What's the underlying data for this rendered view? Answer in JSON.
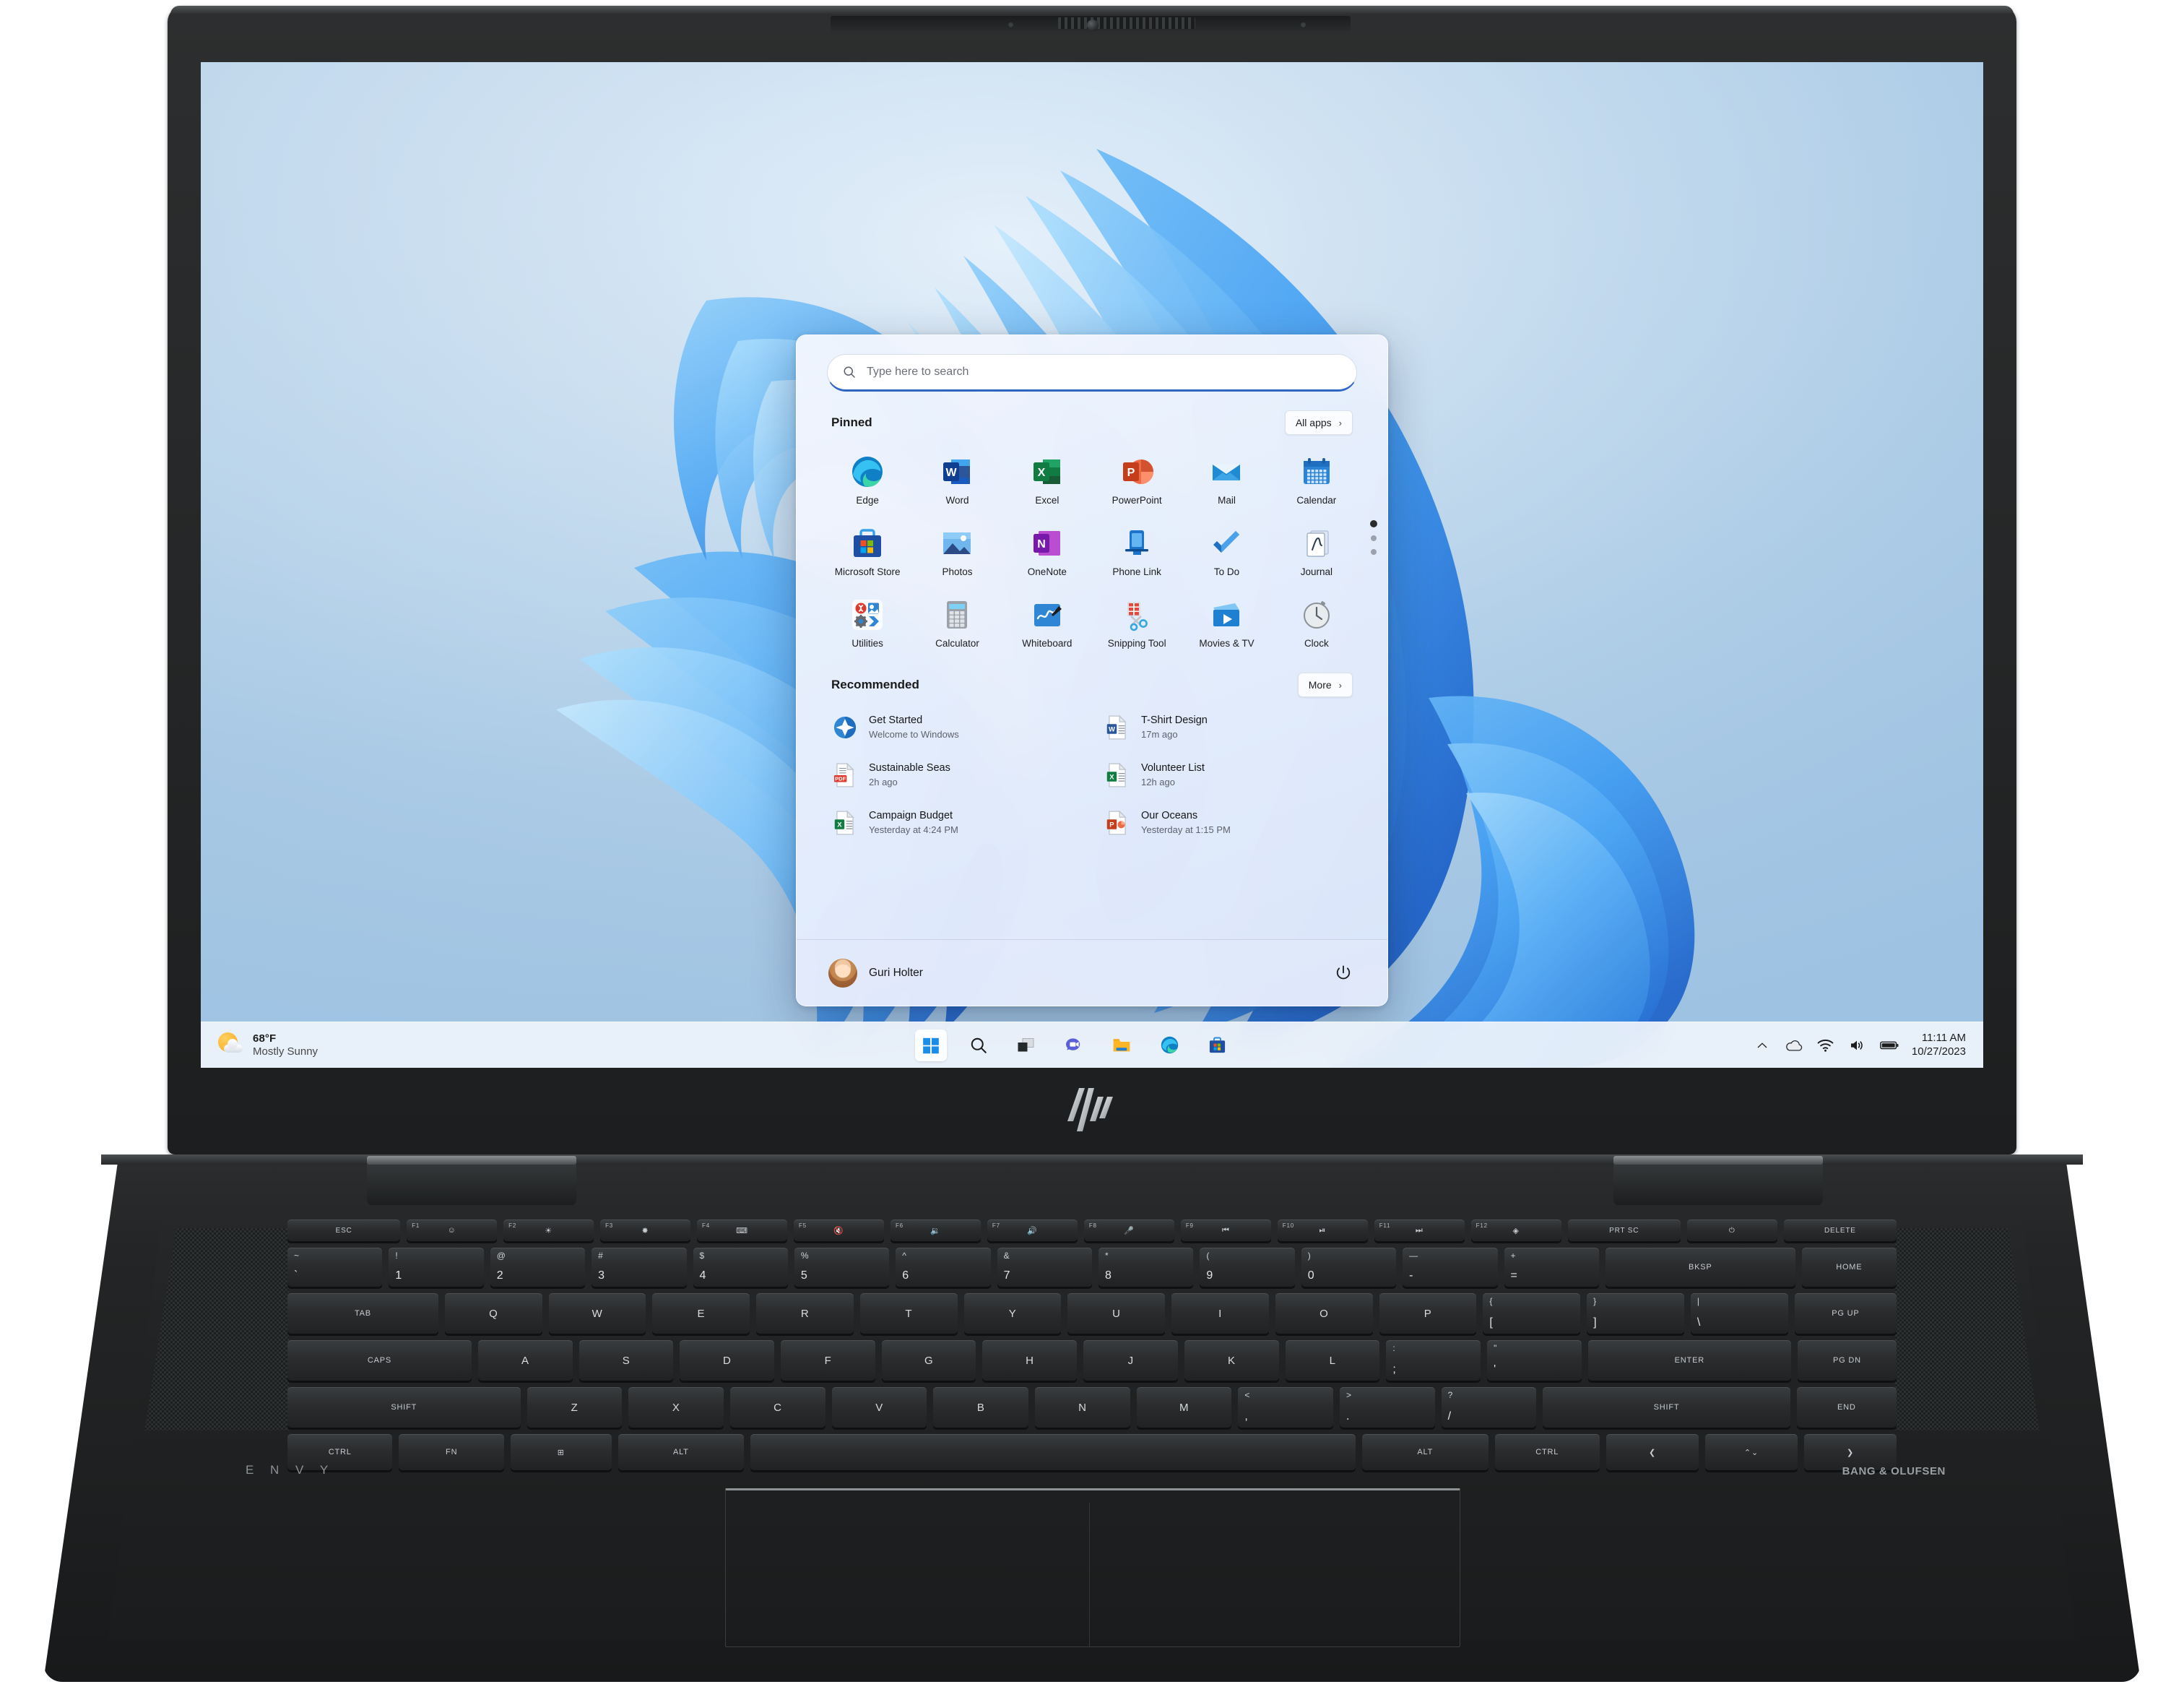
{
  "device": {
    "brand_lid_logo": "hp",
    "brand_deck_left": "E N V Y",
    "brand_deck_right": "BANG & OLUFSEN"
  },
  "desktop": {
    "wallpaper_name": "windows-11-bloom-wallpaper"
  },
  "start_menu": {
    "search": {
      "icon": "search-icon",
      "placeholder": "Type here to search",
      "value": ""
    },
    "pinned": {
      "title": "Pinned",
      "all_apps_label": "All apps",
      "all_apps_chevron": "›",
      "page_dots": 3,
      "active_dot": 0,
      "apps": [
        {
          "label": "Edge",
          "icon": "edge-icon"
        },
        {
          "label": "Word",
          "icon": "word-icon"
        },
        {
          "label": "Excel",
          "icon": "excel-icon"
        },
        {
          "label": "PowerPoint",
          "icon": "powerpoint-icon"
        },
        {
          "label": "Mail",
          "icon": "mail-icon"
        },
        {
          "label": "Calendar",
          "icon": "calendar-icon"
        },
        {
          "label": "Microsoft Store",
          "icon": "microsoft-store-icon"
        },
        {
          "label": "Photos",
          "icon": "photos-icon"
        },
        {
          "label": "OneNote",
          "icon": "onenote-icon"
        },
        {
          "label": "Phone Link",
          "icon": "phone-link-icon"
        },
        {
          "label": "To Do",
          "icon": "to-do-icon"
        },
        {
          "label": "Journal",
          "icon": "journal-icon"
        },
        {
          "label": "Utilities",
          "icon": "utilities-folder-icon"
        },
        {
          "label": "Calculator",
          "icon": "calculator-icon"
        },
        {
          "label": "Whiteboard",
          "icon": "whiteboard-icon"
        },
        {
          "label": "Snipping Tool",
          "icon": "snipping-tool-icon"
        },
        {
          "label": "Movies & TV",
          "icon": "movies-tv-icon"
        },
        {
          "label": "Clock",
          "icon": "clock-icon"
        }
      ]
    },
    "recommended": {
      "title": "Recommended",
      "more_label": "More",
      "more_chevron": "›",
      "items": [
        {
          "title": "Get Started",
          "subtitle": "Welcome to Windows",
          "icon": "get-started-icon"
        },
        {
          "title": "T-Shirt Design",
          "subtitle": "17m ago",
          "icon": "word-doc-icon"
        },
        {
          "title": "Sustainable Seas",
          "subtitle": "2h ago",
          "icon": "pdf-doc-icon"
        },
        {
          "title": "Volunteer List",
          "subtitle": "12h ago",
          "icon": "excel-doc-icon"
        },
        {
          "title": "Campaign Budget",
          "subtitle": "Yesterday at 4:24 PM",
          "icon": "excel-doc-icon"
        },
        {
          "title": "Our Oceans",
          "subtitle": "Yesterday at 1:15 PM",
          "icon": "powerpoint-doc-icon"
        }
      ]
    },
    "account": {
      "user_name": "Guri Holter",
      "avatar": "user-avatar",
      "power_icon": "power-icon"
    }
  },
  "taskbar": {
    "weather": {
      "icon": "partly-sunny-icon",
      "temperature": "68°F",
      "condition": "Mostly Sunny"
    },
    "buttons": [
      {
        "name": "start-button",
        "icon": "windows-logo-icon",
        "active": true
      },
      {
        "name": "search-button",
        "icon": "search-icon",
        "active": false
      },
      {
        "name": "task-view-button",
        "icon": "task-view-icon",
        "active": false
      },
      {
        "name": "chat-button",
        "icon": "chat-teams-icon",
        "active": false
      },
      {
        "name": "file-explorer-button",
        "icon": "file-explorer-icon",
        "active": false
      },
      {
        "name": "edge-button",
        "icon": "edge-icon",
        "active": false
      },
      {
        "name": "store-button",
        "icon": "microsoft-store-icon",
        "active": false
      }
    ],
    "tray": {
      "overflow_chevron": "⌃",
      "icons": [
        "onedrive-cloud-icon",
        "wifi-icon",
        "volume-icon",
        "battery-icon"
      ],
      "time": "11:11 AM",
      "date": "10/27/2023"
    }
  },
  "keyboard": {
    "fn_row": [
      {
        "main": "ESC"
      },
      {
        "fnum": "F1",
        "glyph": "☺"
      },
      {
        "fnum": "F2",
        "glyph": "☀"
      },
      {
        "fnum": "F3",
        "glyph": "✸"
      },
      {
        "fnum": "F4",
        "glyph": "⌨"
      },
      {
        "fnum": "F5",
        "glyph": "🔇"
      },
      {
        "fnum": "F6",
        "glyph": "🔉"
      },
      {
        "fnum": "F7",
        "glyph": "🔊"
      },
      {
        "fnum": "F8",
        "glyph": "🎤"
      },
      {
        "fnum": "F9",
        "glyph": "⏮"
      },
      {
        "fnum": "F10",
        "glyph": "⏯"
      },
      {
        "fnum": "F11",
        "glyph": "⏭"
      },
      {
        "fnum": "F12",
        "glyph": "◈"
      },
      {
        "main": "PRT SC"
      },
      {
        "main": "⏻"
      },
      {
        "main": "DELETE"
      }
    ],
    "number_row": [
      {
        "sub": "~",
        "main": "`"
      },
      {
        "sub": "!",
        "main": "1"
      },
      {
        "sub": "@",
        "main": "2"
      },
      {
        "sub": "#",
        "main": "3"
      },
      {
        "sub": "$",
        "main": "4"
      },
      {
        "sub": "%",
        "main": "5"
      },
      {
        "sub": "^",
        "main": "6"
      },
      {
        "sub": "&",
        "main": "7"
      },
      {
        "sub": "*",
        "main": "8"
      },
      {
        "sub": "(",
        "main": "9"
      },
      {
        "sub": ")",
        "main": "0"
      },
      {
        "sub": "—",
        "main": "-"
      },
      {
        "sub": "+",
        "main": "="
      },
      {
        "main": "BKSP"
      },
      {
        "main": "HOME"
      }
    ],
    "top_row": [
      "TAB",
      "Q",
      "W",
      "E",
      "R",
      "T",
      "Y",
      "U",
      "I",
      "O",
      "P",
      "[",
      "]",
      "\\",
      "PG UP"
    ],
    "home_row": [
      "CAPS",
      "A",
      "S",
      "D",
      "F",
      "G",
      "H",
      "J",
      "K",
      "L",
      ";",
      "'",
      "ENTER",
      "PG DN"
    ],
    "bottom_row": [
      "SHIFT",
      "Z",
      "X",
      "C",
      "V",
      "B",
      "N",
      "M",
      ",",
      ".",
      "/",
      "SHIFT",
      "END"
    ],
    "mod_row": [
      "CTRL",
      "FN",
      "⊞",
      "ALT",
      "",
      "ALT",
      "CTRL",
      "❮",
      "⌃⌄",
      "❯"
    ]
  }
}
